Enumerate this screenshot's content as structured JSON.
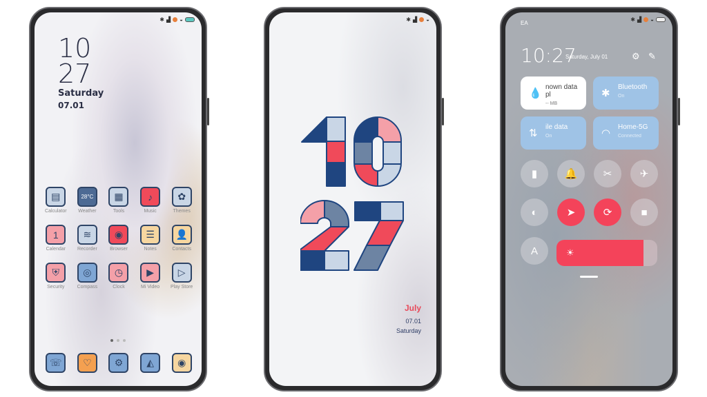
{
  "colors": {
    "navy": "#1f4580",
    "light": "#c9d6e6",
    "red": "#f04a5a",
    "pink": "#f4a0a8",
    "slate": "#6d84a3",
    "accent": "#f4435a"
  },
  "home": {
    "clock": {
      "hour": "10",
      "minute": "27",
      "day": "Saturday",
      "date": "07.01"
    },
    "apps": [
      {
        "label": "Calculator",
        "icon": "calculator-icon",
        "glyph": "▤",
        "bg": "#c9d6e6"
      },
      {
        "label": "Weather",
        "icon": "weather-icon",
        "glyph": "28°C",
        "bg": "#4d6a94"
      },
      {
        "label": "Tools",
        "icon": "tools-folder-icon",
        "glyph": "▦",
        "bg": "#c9d6e6"
      },
      {
        "label": "Music",
        "icon": "music-icon",
        "glyph": "♪",
        "bg": "#f04a5a"
      },
      {
        "label": "Themes",
        "icon": "themes-icon",
        "glyph": "✿",
        "bg": "#c9d6e6"
      },
      {
        "label": "Calendar",
        "icon": "calendar-icon",
        "glyph": "1",
        "bg": "#f4a0a8"
      },
      {
        "label": "Recorder",
        "icon": "recorder-icon",
        "glyph": "≋",
        "bg": "#c9d6e6"
      },
      {
        "label": "Browser",
        "icon": "browser-icon",
        "glyph": "◉",
        "bg": "#f04a5a"
      },
      {
        "label": "Notes",
        "icon": "notes-icon",
        "glyph": "☰",
        "bg": "#f6d6a0"
      },
      {
        "label": "Contacts",
        "icon": "contacts-icon",
        "glyph": "👤",
        "bg": "#f6d6a0"
      },
      {
        "label": "Security",
        "icon": "security-icon",
        "glyph": "⛨",
        "bg": "#f4a0a8"
      },
      {
        "label": "Compass",
        "icon": "compass-icon",
        "glyph": "◎",
        "bg": "#7fa6d4"
      },
      {
        "label": "Clock",
        "icon": "clock-icon",
        "glyph": "◷",
        "bg": "#f4a0a8"
      },
      {
        "label": "Mi Video",
        "icon": "video-icon",
        "glyph": "▶",
        "bg": "#f4a0a8"
      },
      {
        "label": "Play Store",
        "icon": "play-store-icon",
        "glyph": "▷",
        "bg": "#c9d6e6"
      }
    ],
    "dock": [
      {
        "icon": "phone-icon",
        "glyph": "☏",
        "bg": "#7fa6d4"
      },
      {
        "icon": "messages-icon",
        "glyph": "♡",
        "bg": "#f4a050"
      },
      {
        "icon": "settings-icon",
        "glyph": "⚙",
        "bg": "#7fa6d4"
      },
      {
        "icon": "gallery-icon",
        "glyph": "◭",
        "bg": "#7fa6d4"
      },
      {
        "icon": "camera-icon",
        "glyph": "◉",
        "bg": "#f6d6a0"
      }
    ]
  },
  "lock": {
    "hour": "10",
    "minute": "27",
    "month": "July",
    "date": "07.01",
    "day": "Saturday"
  },
  "control": {
    "carrier": "EA",
    "time": "10:27",
    "date": "Saturday, July 01",
    "tiles": [
      {
        "title": "nown data pl",
        "sub": "-- MB",
        "icon": "drop-icon",
        "glyph": "💧",
        "white": true
      },
      {
        "title": "Bluetooth",
        "sub": "On",
        "icon": "bluetooth-icon",
        "glyph": "✱"
      },
      {
        "title": "ile data",
        "sub": "On",
        "icon": "mobile-data-icon",
        "glyph": "⇅"
      },
      {
        "title": "Home-5G",
        "sub": "Connected",
        "icon": "wifi-icon",
        "glyph": "◠"
      }
    ],
    "toggles": [
      {
        "icon": "flashlight-icon",
        "glyph": "▮",
        "on": false
      },
      {
        "icon": "bell-icon",
        "glyph": "🔔",
        "on": false
      },
      {
        "icon": "screenshot-icon",
        "glyph": "✂",
        "on": false
      },
      {
        "icon": "airplane-icon",
        "glyph": "✈",
        "on": false
      },
      {
        "icon": "reading-mode-icon",
        "glyph": "◐",
        "on": false
      },
      {
        "icon": "location-icon",
        "glyph": "➤",
        "on": true
      },
      {
        "icon": "rotation-lock-icon",
        "glyph": "⟳",
        "on": true
      },
      {
        "icon": "video-camera-icon",
        "glyph": "■",
        "on": false
      },
      {
        "icon": "auto-brightness-icon",
        "glyph": "A",
        "on": false
      }
    ],
    "brightness": 0.86
  }
}
